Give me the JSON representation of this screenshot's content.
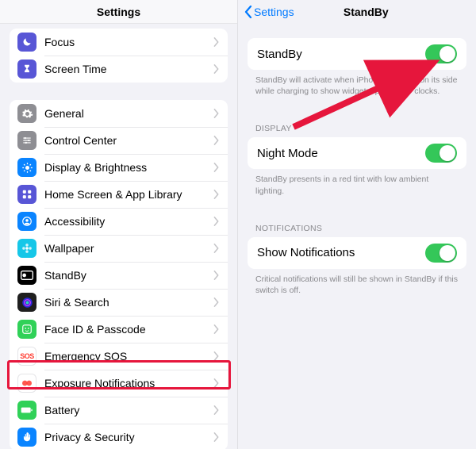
{
  "left": {
    "title": "Settings",
    "group1": [
      {
        "name": "focus",
        "label": "Focus",
        "bg": "#5856d6",
        "glyph": "moon"
      },
      {
        "name": "screen-time",
        "label": "Screen Time",
        "bg": "#5856d6",
        "glyph": "hourglass"
      }
    ],
    "group2": [
      {
        "name": "general",
        "label": "General",
        "bg": "#8e8e93",
        "glyph": "gear"
      },
      {
        "name": "control-center",
        "label": "Control Center",
        "bg": "#8e8e93",
        "glyph": "sliders"
      },
      {
        "name": "display-brightness",
        "label": "Display & Brightness",
        "bg": "#0a84ff",
        "glyph": "sun"
      },
      {
        "name": "home-screen",
        "label": "Home Screen & App Library",
        "bg": "#5856d6",
        "glyph": "grid"
      },
      {
        "name": "accessibility",
        "label": "Accessibility",
        "bg": "#0a84ff",
        "glyph": "person"
      },
      {
        "name": "wallpaper",
        "label": "Wallpaper",
        "bg": "#16c7e8",
        "glyph": "flower"
      },
      {
        "name": "standby",
        "label": "StandBy",
        "bg": "#000000",
        "glyph": "standby"
      },
      {
        "name": "siri-search",
        "label": "Siri & Search",
        "bg": "#1f1f1f",
        "glyph": "siri"
      },
      {
        "name": "faceid",
        "label": "Face ID & Passcode",
        "bg": "#30d158",
        "glyph": "face"
      },
      {
        "name": "emergency-sos",
        "label": "Emergency SOS",
        "bg": "#ffffff",
        "glyph": "sos"
      },
      {
        "name": "exposure",
        "label": "Exposure Notifications",
        "bg": "#ffffff",
        "glyph": "exposure"
      },
      {
        "name": "battery",
        "label": "Battery",
        "bg": "#30d158",
        "glyph": "battery"
      },
      {
        "name": "privacy",
        "label": "Privacy & Security",
        "bg": "#0a84ff",
        "glyph": "hand"
      }
    ],
    "highlight_index": 6
  },
  "right": {
    "back_label": "Settings",
    "title": "StandBy",
    "sec1": {
      "cell_label": "StandBy",
      "toggle_on": true,
      "footnote": "StandBy will activate when iPhone is placed on its side while charging to show widgets, photos, or clocks."
    },
    "sec2": {
      "header": "DISPLAY",
      "cell_label": "Night Mode",
      "toggle_on": true,
      "footnote": "StandBy presents in a red tint with low ambient lighting."
    },
    "sec3": {
      "header": "NOTIFICATIONS",
      "cell_label": "Show Notifications",
      "toggle_on": true,
      "footnote": "Critical notifications will still be shown in StandBy if this switch is off."
    }
  }
}
